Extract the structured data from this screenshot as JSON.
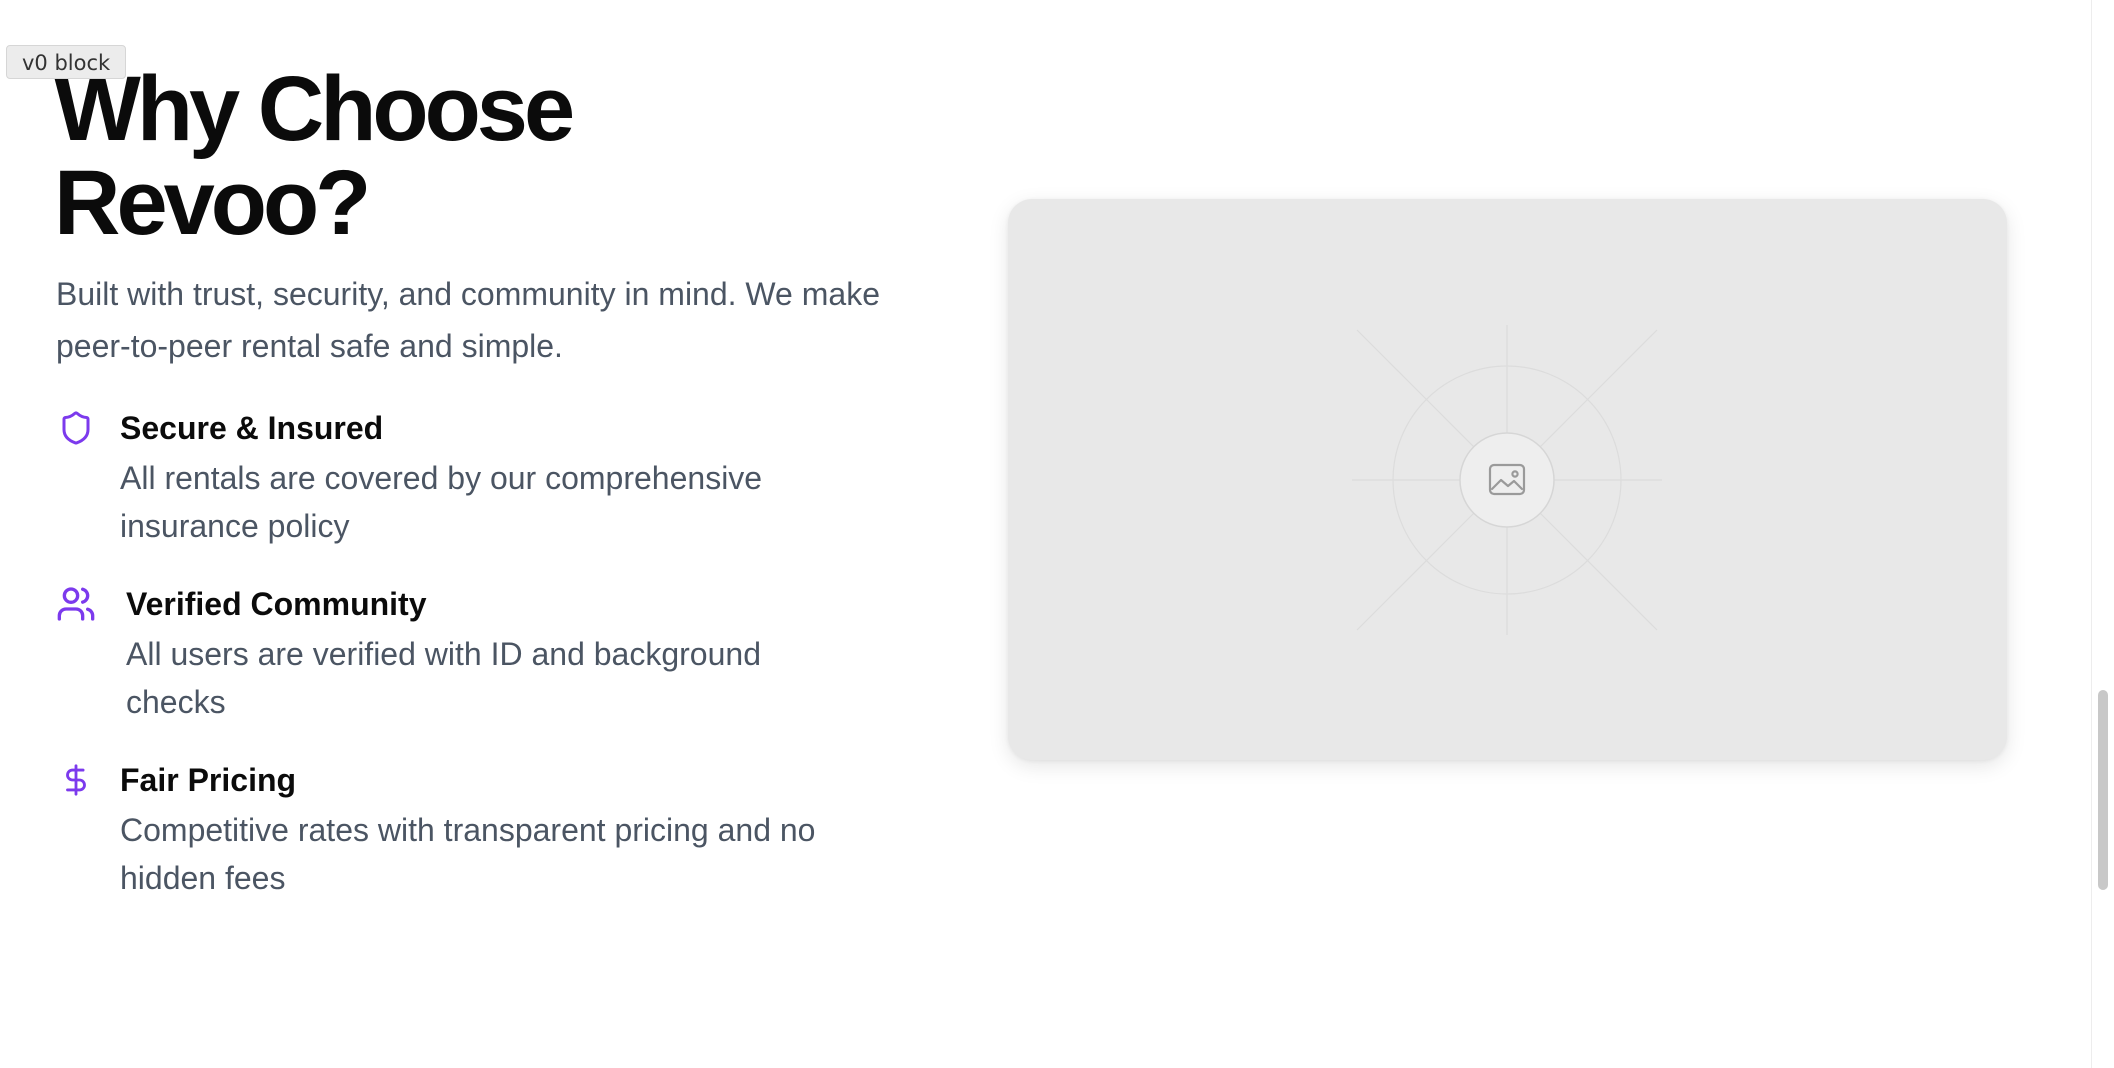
{
  "badge": {
    "label": "v0 block"
  },
  "hero": {
    "title_line1": "Why Choose",
    "title_line2": "Revoo?",
    "subtitle": "Built with trust, security, and community in mind. We make peer-to-peer rental safe and simple."
  },
  "features": [
    {
      "icon": "shield-icon",
      "title": "Secure & Insured",
      "description": "All rentals are covered by our comprehensive insurance policy"
    },
    {
      "icon": "users-icon",
      "title": "Verified Community",
      "description": "All users are verified with ID and background checks"
    },
    {
      "icon": "dollar-sign-icon",
      "title": "Fair Pricing",
      "description": "Competitive rates with transparent pricing and no hidden fees"
    }
  ],
  "image_placeholder": {
    "icon": "image-icon"
  },
  "colors": {
    "accent": "#7c3aed",
    "heading": "#0b0b0b",
    "body_text": "#4b5563",
    "placeholder_bg": "#e8e8e8"
  }
}
